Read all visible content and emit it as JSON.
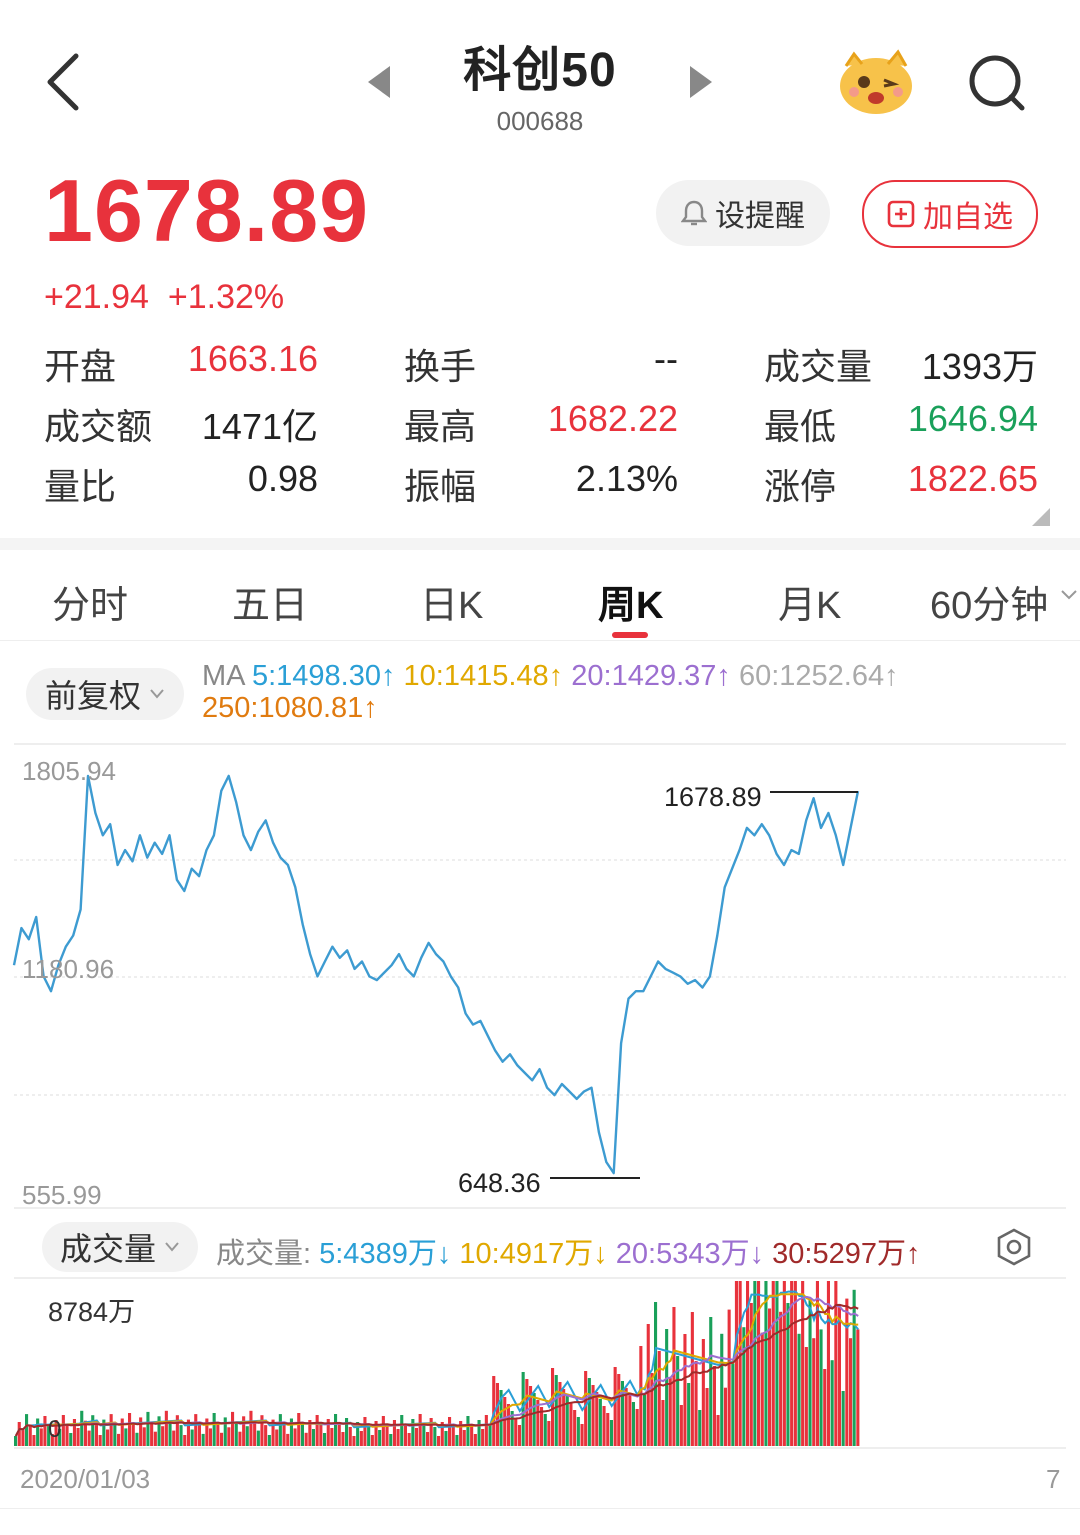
{
  "header": {
    "title": "科创50",
    "code": "000688"
  },
  "quote": {
    "price": "1678.89",
    "change": "+21.94",
    "change_pct": "+1.32%",
    "alert_label": "设提醒",
    "add_label": "加自选"
  },
  "stats": [
    {
      "label": "开盘",
      "value": "1663.16",
      "color": "red"
    },
    {
      "label": "换手",
      "value": "--",
      "color": "dark"
    },
    {
      "label": "成交量",
      "value": "1393万",
      "color": "dark"
    },
    {
      "label": "成交额",
      "value": "1471亿",
      "color": "dark"
    },
    {
      "label": "最高",
      "value": "1682.22",
      "color": "red"
    },
    {
      "label": "最低",
      "value": "1646.94",
      "color": "green"
    },
    {
      "label": "量比",
      "value": "0.98",
      "color": "dark"
    },
    {
      "label": "振幅",
      "value": "2.13%",
      "color": "dark"
    },
    {
      "label": "涨停",
      "value": "1822.65",
      "color": "red"
    }
  ],
  "tabs": [
    "分时",
    "五日",
    "日K",
    "周K",
    "月K",
    "60分钟"
  ],
  "active_tab": "周K",
  "ma": {
    "adjust_label": "前复权",
    "prefix": "MA",
    "ma5": "5:1498.30↑",
    "ma10": "10:1415.48↑",
    "ma20": "20:1429.37↑",
    "ma60": "60:1252.64↑",
    "ma250": "250:1080.81↑"
  },
  "vol": {
    "label": "成交量",
    "prefix": "成交量:",
    "v5": "5:4389万↓",
    "v10": "10:4917万↓",
    "v20": "20:5343万↓",
    "v30": "30:5297万↑",
    "max_label": "8784万",
    "zero_label": "0"
  },
  "axis": {
    "top": "1805.94",
    "mid": "1180.96",
    "bottom": "555.99",
    "date_start": "2020/01/03",
    "date_end_fragment": "7"
  },
  "chart_data": {
    "type": "line",
    "title": "",
    "ylim": [
      555.99,
      1805.94
    ],
    "annotations": [
      {
        "label": "1678.89",
        "value": 1678.89
      },
      {
        "label": "648.36",
        "value": 648.36
      }
    ],
    "series": [
      {
        "values": [
          1210,
          1310,
          1280,
          1340,
          1180,
          1140,
          1210,
          1260,
          1290,
          1360,
          1720,
          1620,
          1560,
          1590,
          1480,
          1520,
          1490,
          1560,
          1500,
          1540,
          1510,
          1560,
          1440,
          1410,
          1470,
          1450,
          1520,
          1560,
          1680,
          1720,
          1650,
          1560,
          1520,
          1570,
          1600,
          1540,
          1500,
          1480,
          1420,
          1320,
          1240,
          1180,
          1220,
          1260,
          1230,
          1250,
          1200,
          1220,
          1180,
          1170,
          1190,
          1210,
          1240,
          1200,
          1180,
          1230,
          1270,
          1240,
          1220,
          1180,
          1150,
          1080,
          1050,
          1060,
          1020,
          980,
          950,
          970,
          940,
          920,
          900,
          930,
          880,
          860,
          890,
          870,
          850,
          870,
          880,
          760,
          680,
          650,
          1000,
          1120,
          1140,
          1140,
          1180,
          1220,
          1200,
          1190,
          1180,
          1160,
          1170,
          1150,
          1180,
          1290,
          1420,
          1470,
          1520,
          1580,
          1560,
          1590,
          1560,
          1510,
          1480,
          1520,
          1510,
          1600,
          1660,
          1580,
          1620,
          1560,
          1480,
          1580,
          1679
        ]
      },
      {
        "name": "",
        "values": []
      }
    ]
  },
  "colors": {
    "up": "#e8323c",
    "down": "#1aa05a",
    "line": "#3d9bd1"
  }
}
